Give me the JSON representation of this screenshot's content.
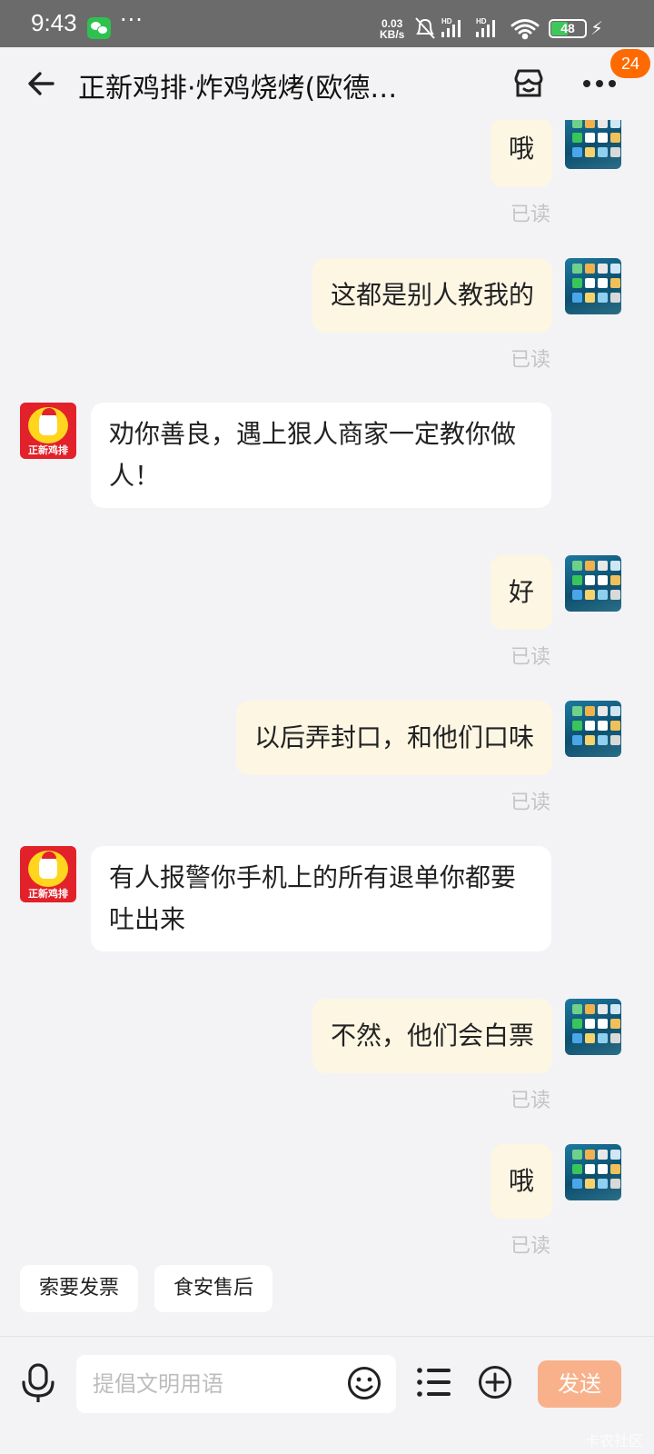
{
  "status_bar": {
    "time": "9:43",
    "speed_value": "0.03",
    "speed_unit": "KB/s",
    "network_labels": [
      "HD",
      "HD"
    ],
    "battery": "48",
    "battery_level": 0.48,
    "battery_color": "#3fc75a"
  },
  "header": {
    "title": "正新鸡排·炸鸡烧烤(欧德…",
    "badge": "24",
    "badge_color": "#ff6a00",
    "icons": [
      "back-arrow-icon",
      "shop-icon",
      "more-icon"
    ]
  },
  "messages": [
    {
      "side": "out",
      "text": "哦",
      "status": "已读"
    },
    {
      "side": "out",
      "text": "这都是别人教我的",
      "status": "已读"
    },
    {
      "side": "in",
      "sender_label": "正新鸡排",
      "lines": [
        "劝你善良，遇上狠人商家一定教你做",
        "人！"
      ]
    },
    {
      "side": "out",
      "text": "好",
      "status": "已读"
    },
    {
      "side": "out",
      "text": "以后弄封口，和他们口味",
      "status": "已读"
    },
    {
      "side": "in",
      "sender_label": "正新鸡排",
      "lines": [
        "有人报警你手机上的所有退单你都要",
        "吐出来"
      ]
    },
    {
      "side": "out",
      "text": "不然，他们会白票",
      "status": "已读"
    },
    {
      "side": "out",
      "text": "哦",
      "status": "已读"
    }
  ],
  "quick_actions": [
    "索要发票",
    "食安售后"
  ],
  "composer": {
    "placeholder": "提倡文明用语",
    "send_label": "发送",
    "send_color": "#f8b18a"
  },
  "watermark": "卡农社区",
  "colors": {
    "outgoing_bubble": "#fdf6e3",
    "incoming_bubble": "#ffffff",
    "background": "#f3f3f5"
  }
}
